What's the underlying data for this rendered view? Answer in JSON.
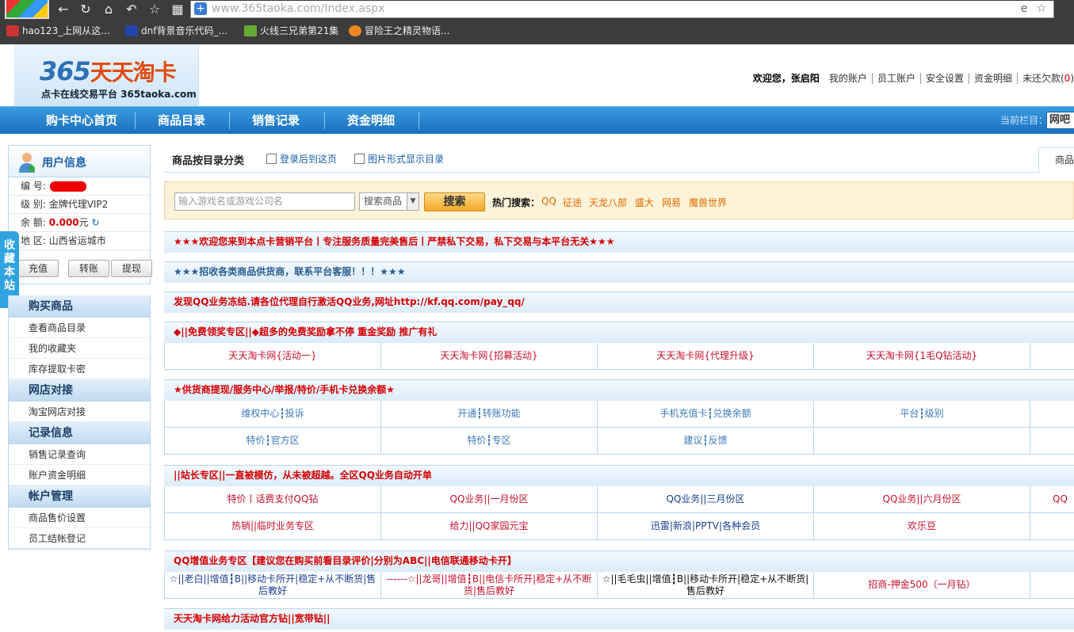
{
  "browser": {
    "url": "www.365taoka.com/Index.aspx",
    "bookmarks": [
      "hao123_上网从这...",
      "dnf背景音乐代码_...",
      "火线三兄弟第21集",
      "冒险王之精灵物语..."
    ]
  },
  "header": {
    "logo_main": "365",
    "logo_cn": "天天淘卡",
    "logo_sub": "点卡在线交易平台 365taoka.com",
    "welcome": "欢迎您，张启阳",
    "links": [
      "我的账户",
      "员工账户",
      "安全设置",
      "资金明细"
    ],
    "debt_label": "未还欠款(",
    "debt_value": "0",
    "debt_close": ")"
  },
  "mainnav": {
    "items": [
      "购卡中心首页",
      "商品目录",
      "销售记录",
      "资金明细"
    ],
    "current_label": "当前栏目：",
    "current_value": "网吧售"
  },
  "user": {
    "title": "用户信息",
    "id_label": "编 号:",
    "level_label": "级 别:",
    "level_value": "金牌代理VIP2",
    "balance_label": "余 额:",
    "balance_value": "0.000",
    "balance_unit": "元",
    "region_label": "地 区:",
    "region_value": "山西省运城市",
    "buttons": [
      "充值",
      "转账",
      "提现"
    ]
  },
  "favorite": "收藏本站",
  "menu": [
    {
      "group": "购买商品",
      "items": [
        "查看商品目录",
        "我的收藏夹",
        "库存提取卡密"
      ]
    },
    {
      "group": "网店对接",
      "items": [
        "淘宝网店对接"
      ]
    },
    {
      "group": "记录信息",
      "items": [
        "销售记录查询",
        "账户资金明细"
      ]
    },
    {
      "group": "帐户管理",
      "items": [
        "商品售价设置",
        "员工结帐登记"
      ]
    }
  ],
  "catalog": {
    "title": "商品按目录分类",
    "check1": "登录后到这页",
    "check2": "图片形式显示目录",
    "tab": "商品"
  },
  "search": {
    "placeholder": "输入游戏名或游戏公司名",
    "select": "搜索商品",
    "button": "搜索",
    "hot_label": "热门搜索：",
    "hot_words": [
      "QQ",
      "征途",
      "天龙八部",
      "盛大",
      "网易",
      "魔兽世界"
    ]
  },
  "notices": [
    "★★★欢迎您来到本点卡营销平台丨专注服务质量完美售后丨严禁私下交易，私下交易与本平台无关★★★",
    "★★★招收各类商品供货商，联系平台客服！！！★★★",
    "发现QQ业务冻结.请各位代理自行激活QQ业务,网址http://kf.qq.com/pay_qq/"
  ],
  "sections": [
    {
      "title": "◆||免费领奖专区||◆超多的免费奖励拿不停 重金奖励 推广有礼",
      "rows": [
        [
          "天天淘卡网{活动一}",
          "天天淘卡网{招募活动}",
          "天天淘卡网{代理升级}",
          "天天淘卡网{1毛Q钻活动}"
        ]
      ]
    },
    {
      "title": "★供货商提现/服务中心/举报/特价/手机卡兑换余额★",
      "rows": [
        [
          "维权中心┇投诉",
          "开通┇转账功能",
          "手机充值卡┇兑换余额",
          "平台┇级别"
        ],
        [
          "特价┇官方区",
          "特价┇专区",
          "建议┇反馈",
          ""
        ]
      ]
    },
    {
      "title": "||站长专区||一直被模仿，从未被超越。全区QQ业务自动开单",
      "rows": [
        [
          "特价丨话费支付QQ钻",
          "QQ业务||一月份区",
          "QQ业务||三月份区",
          "QQ业务||六月份区",
          "QQ"
        ],
        [
          "热销||临时业务专区",
          "给力||QQ家园元宝",
          "迅雷|新浪|PPTV|各种会员",
          "欢乐豆"
        ]
      ]
    },
    {
      "title": "QQ增值业务专区【建议您在购买前看目录评价|分别为ABC||电信联通移动卡开】",
      "rows": [
        [
          "☆||老白||增值┇B||移动卡所开|稳定+从不断货|售后教好",
          "------☆||龙哥||增值┇B||电信卡所开|稳定+从不断货|售后教好",
          "☆||毛毛虫||增值┇B||移动卡所开|稳定+从不断货|售后教好",
          "招商-押金500（一月钻）"
        ]
      ]
    },
    {
      "title": "天天淘卡网给力活动官方钻||宽带钻||",
      "rows": []
    }
  ]
}
